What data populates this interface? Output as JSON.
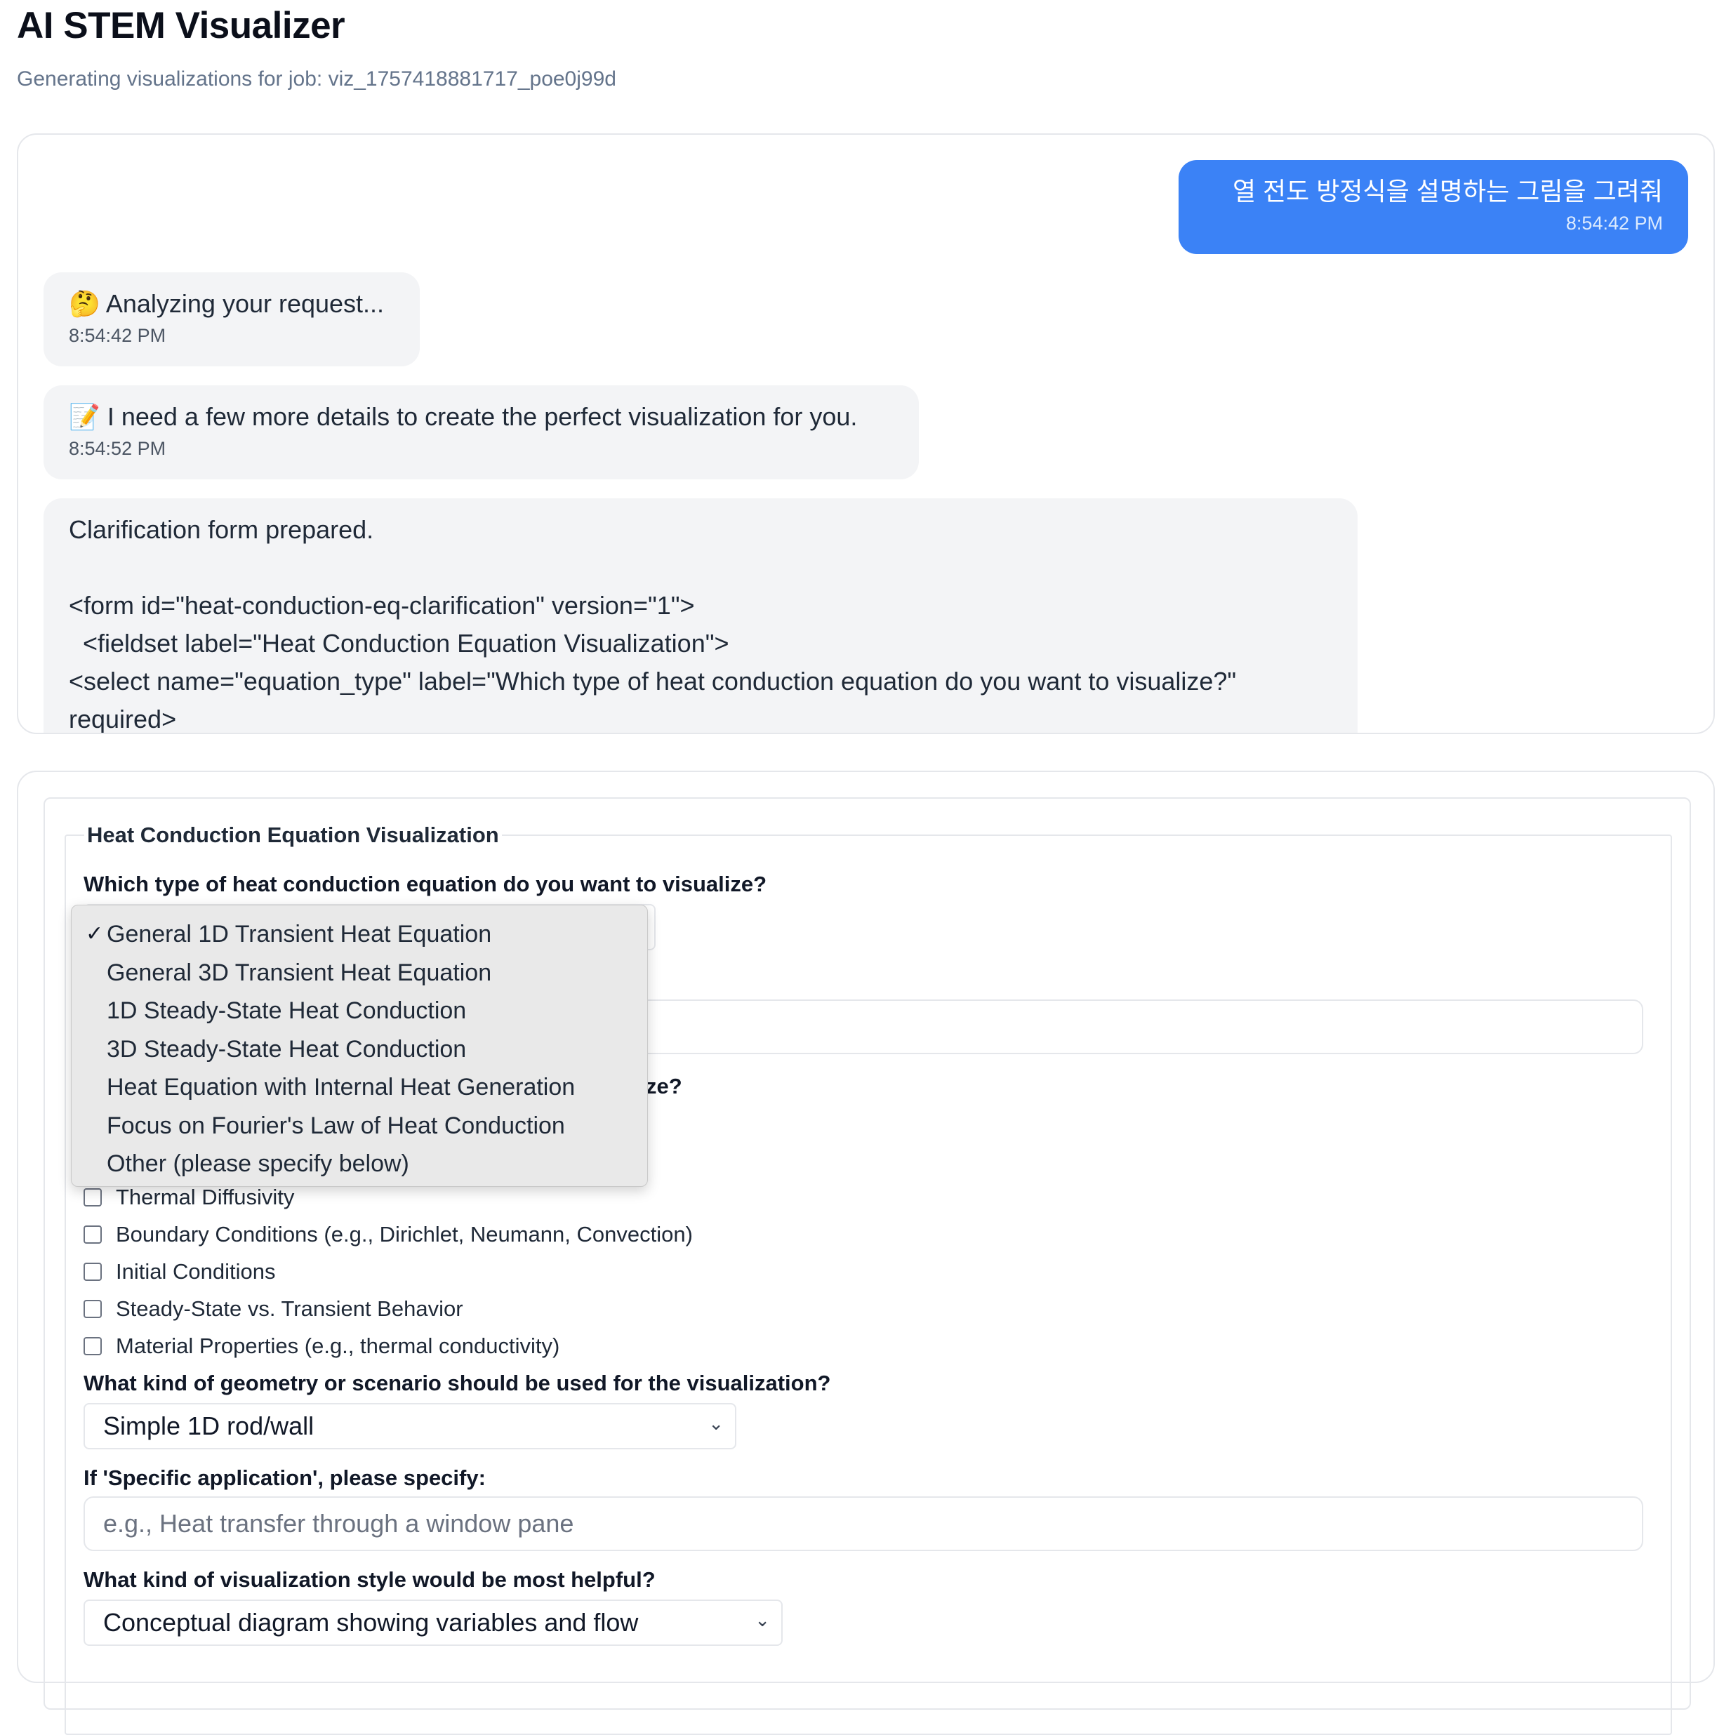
{
  "header": {
    "title": "AI STEM Visualizer",
    "subtitle": "Generating visualizations for job: viz_1757418881717_poe0j99d"
  },
  "chat": {
    "user_message": {
      "text": "열 전도 방정식을 설명하는 그림을 그려줘",
      "time": "8:54:42 PM"
    },
    "bot_messages": [
      {
        "emoji": "🤔",
        "text": "Analyzing your request...",
        "time": "8:54:42 PM"
      },
      {
        "emoji": "📝",
        "text": "I need a few more details to create the perfect visualization for you.",
        "time": "8:54:52 PM"
      }
    ],
    "form_message": {
      "line1": "Clarification form prepared.",
      "line2": "<form id=\"heat-conduction-eq-clarification\" version=\"1\">",
      "line3": "  <fieldset label=\"Heat Conduction Equation Visualization\">",
      "line4": "    <select name=\"equation_type\" label=\"Which type of heat conduction equation do you want to visualize?\" required>"
    }
  },
  "form": {
    "legend": "Heat Conduction Equation Visualization",
    "q_equation_type": "Which type of heat conduction equation do you want to visualize?",
    "equation_type_options": [
      "General 1D Transient Heat Equation",
      "General 3D Transient Heat Equation",
      "1D Steady-State Heat Conduction",
      "3D Steady-State Heat Conduction",
      "Heat Equation with Internal Heat Generation",
      "Focus on Fourier's Law of Heat Conduction",
      "Other (please specify below)"
    ],
    "equation_type_selected_index": 0,
    "q_emphasize_partial": "ze?",
    "checkbox_partial": "Thermal Diffusivity",
    "checkboxes": [
      "Boundary Conditions (e.g., Dirichlet, Neumann, Convection)",
      "Initial Conditions",
      "Steady-State vs. Transient Behavior",
      "Material Properties (e.g., thermal conductivity)"
    ],
    "q_geometry": "What kind of geometry or scenario should be used for the visualization?",
    "geometry_selected": "Simple 1D rod/wall",
    "q_specific_app": "If 'Specific application', please specify:",
    "specific_app_placeholder": "e.g., Heat transfer through a window pane",
    "q_style": "What kind of visualization style would be most helpful?",
    "style_selected": "Conceptual diagram showing variables and flow"
  },
  "icons": {
    "chevron": "chevron-down-icon",
    "check": "checkmark-icon"
  },
  "colors": {
    "user_bubble": "#3b82f6",
    "bot_bubble": "#f3f4f6",
    "subtitle": "#64748b"
  }
}
